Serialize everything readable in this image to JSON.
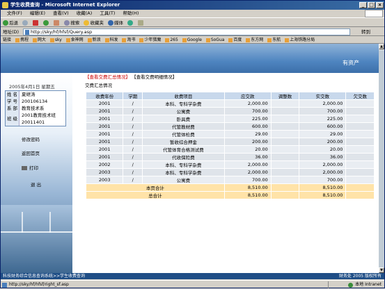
{
  "window": {
    "title": "学生收费查询 - Microsoft Internet Explorer",
    "minimize": "_",
    "maximize": "□",
    "close": "×"
  },
  "menu": [
    "文件(F)",
    "编辑(E)",
    "查看(V)",
    "收藏(A)",
    "工具(T)",
    "帮助(H)"
  ],
  "toolbar": {
    "back": "后退",
    "search": "搜索",
    "favorites": "收藏夹",
    "media": "媒体"
  },
  "address": {
    "label": "地址(D)",
    "url": "http://sky/hf/hfsf/Query.asp",
    "go": "转到"
  },
  "links": {
    "label": "链接",
    "items": [
      "携程",
      "网大",
      "sky",
      "食神网",
      "新浪",
      "科发",
      "淘书",
      "少年猎魔",
      "265",
      "Google",
      "SoGua",
      "百度",
      "东方网",
      "东航",
      "上海铁路分局"
    ]
  },
  "banner": {
    "text": "有资产"
  },
  "sidebar": {
    "date": "2005年4月1日 星期五",
    "info": [
      {
        "label": "姓 名",
        "value": "夏继涛"
      },
      {
        "label": "学 号",
        "value": "200106134"
      },
      {
        "label": "系 部",
        "value": "教育技术系"
      }
    ],
    "class": {
      "label": "班 级",
      "value1": "2001教育技术班",
      "value2": "20011401"
    },
    "links": {
      "password": "修改密码",
      "home": "返回首页",
      "print": "打印",
      "logout": "退 出"
    }
  },
  "main": {
    "tab_summary": "【查看交费汇总情况】",
    "tab_detail": "【查看交费明细情况】",
    "subtitle": "交费汇总情况",
    "columns": [
      "收费年份",
      "学期",
      "收费项目",
      "应交款",
      "调整数",
      "实交数",
      "欠交数"
    ],
    "rows": [
      [
        "2001",
        "/",
        "本科、专科学杂费",
        "2,000.00",
        "",
        "2,000.00",
        ""
      ],
      [
        "2001",
        "/",
        "公寓费",
        "700.00",
        "",
        "700.00",
        ""
      ],
      [
        "2001",
        "/",
        "卧具费",
        "225.00",
        "",
        "225.00",
        ""
      ],
      [
        "2001",
        "/",
        "代管教材费",
        "600.00",
        "",
        "600.00",
        ""
      ],
      [
        "2001",
        "/",
        "代管体检费",
        "29.00",
        "",
        "29.00",
        ""
      ],
      [
        "2001",
        "/",
        "暂收综合押金",
        "200.00",
        "",
        "200.00",
        ""
      ],
      [
        "2001",
        "/",
        "代管体育合格测试费",
        "20.00",
        "",
        "20.00",
        ""
      ],
      [
        "2001",
        "/",
        "代收保险费",
        "36.00",
        "",
        "36.00",
        ""
      ],
      [
        "2002",
        "/",
        "本科、专科学杂费",
        "2,000.00",
        "",
        "2,000.00",
        ""
      ],
      [
        "2003",
        "/",
        "本科、专科学杂费",
        "2,000.00",
        "",
        "2,000.00",
        ""
      ],
      [
        "2003",
        "/",
        "公寓费",
        "700.00",
        "",
        "700.00",
        ""
      ]
    ],
    "page_total": {
      "label": "本页合计",
      "due": "8,510.00",
      "paid": "8,510.00"
    },
    "grand_total": {
      "label": "总合计",
      "due": "8,510.00",
      "paid": "8,510.00"
    }
  },
  "footer": {
    "left": "科技财务综合信息查询系统>>学生收费查询",
    "right": "财务处 2005 版权所有"
  },
  "status": {
    "url": "http://sky/hf/hfsf/right_sf.asp",
    "zone": "本地 Intranet"
  }
}
